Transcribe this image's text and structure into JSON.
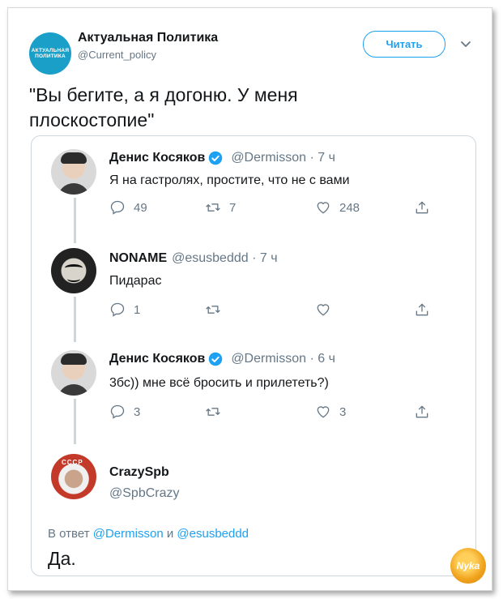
{
  "header": {
    "avatar_text_line1": "АКТУАЛЬНАЯ",
    "avatar_text_line2": "ПОЛИТИКА",
    "name": "Актуальная Политика",
    "handle": "@Current_policy",
    "follow_label": "Читать"
  },
  "tweet_text_line1": "\"Вы бегите, а я догоню. У меня",
  "tweet_text_line2": "плоскостопие\"",
  "thread": [
    {
      "name": "Денис Косяков",
      "verified": true,
      "handle_time": "@Dermisson · 7 ч",
      "text": "Я на гастролях, простите, что не с вами",
      "replies": "49",
      "retweets": "7",
      "likes": "248"
    },
    {
      "name": "NONAME",
      "verified": false,
      "handle_time": "@esusbeddd · 7 ч",
      "text": "Пидарас",
      "replies": "1",
      "retweets": "",
      "likes": ""
    },
    {
      "name": "Денис Косяков",
      "verified": true,
      "handle_time": "@Dermisson · 6 ч",
      "text": "3бс)) мне всё бросить и прилететь?)",
      "replies": "3",
      "retweets": "",
      "likes": "3"
    }
  ],
  "final_reply": {
    "name": "CrazySpb",
    "handle": "@SpbCrazy",
    "reply_prefix": "В ответ",
    "mention1": "@Dermisson",
    "conjunction": "и",
    "mention2": "@esusbeddd",
    "text": "Да."
  },
  "watermark_text": "Nyka",
  "colors": {
    "accent": "#1da1f2",
    "muted": "#657786",
    "border": "#ccd6dd"
  }
}
